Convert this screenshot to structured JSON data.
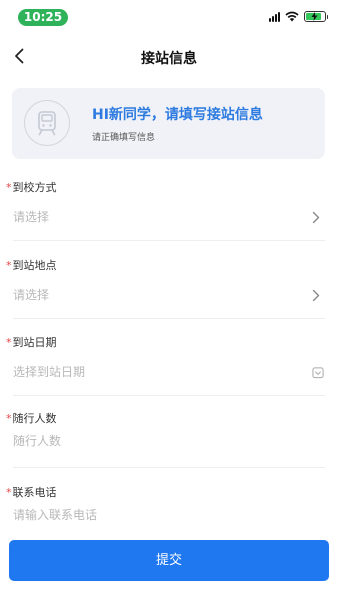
{
  "status_bar": {
    "time": "10:25",
    "accent": "#2fb35a",
    "icons": [
      "signal-icon",
      "wifi-icon",
      "battery-charging-icon"
    ],
    "battery_level": 0.85
  },
  "nav": {
    "back_icon": "chevron-left-icon",
    "title": "接站信息"
  },
  "banner": {
    "icon": "train-icon",
    "title": "HI新同学，请填写接站信息",
    "subtitle": "请正确填写信息",
    "title_color": "#2d7be0"
  },
  "form": {
    "required_mark": "*",
    "fields": [
      {
        "label": "到校方式",
        "placeholder": "请选择",
        "right_icon": "chevron-right-icon"
      },
      {
        "label": "到站地点",
        "placeholder": "请选择",
        "right_icon": "chevron-right-icon"
      },
      {
        "label": "到站日期",
        "placeholder": "选择到站日期",
        "right_icon": "calendar-icon"
      },
      {
        "label": "随行人数",
        "placeholder": "随行人数",
        "right_icon": ""
      },
      {
        "label": "联系电话",
        "placeholder": "请输入联系电话",
        "right_icon": ""
      }
    ]
  },
  "submit": {
    "label": "提交",
    "color": "#1f78f0"
  }
}
